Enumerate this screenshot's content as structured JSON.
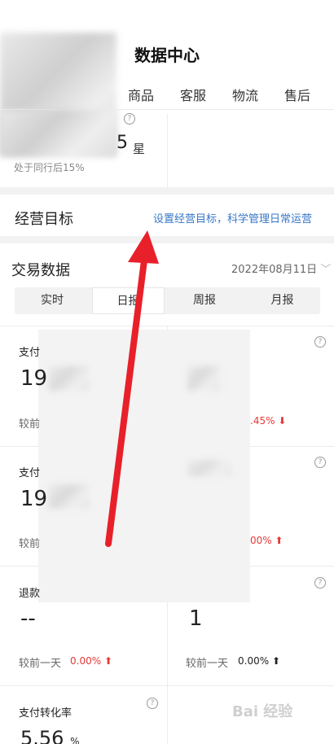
{
  "header": {
    "title": "数据中心"
  },
  "tabs": [
    "商品",
    "客服",
    "物流",
    "售后"
  ],
  "shop_score": {
    "value_suffix": "5",
    "unit": "星",
    "rank_text": "处于同行后15%"
  },
  "business_goal": {
    "title": "经营目标",
    "link": "设置经营目标，科学管理日常运营"
  },
  "trade": {
    "title": "交易数据",
    "date": "2022年08月11日",
    "periods": [
      "实时",
      "日报",
      "周报",
      "月报"
    ],
    "active_period": "日报"
  },
  "metrics": [
    {
      "label": "支付",
      "value": "19",
      "cmp_label": "较前",
      "pct": ".45%",
      "pct_color": "#e53935",
      "trend": "down"
    },
    {
      "label": "支付",
      "value": "19",
      "cmp_label": "较前",
      "pct": "00%",
      "pct_color": "#e53935",
      "trend": "up"
    },
    {
      "label": "退款",
      "value": "--",
      "cmp_label": "较前一天",
      "pct": "0.00%",
      "pct_color": "#e53935",
      "trend": "up"
    },
    {
      "label": "",
      "value": "1",
      "cmp_label": "较前一天",
      "pct": "0.00%",
      "pct_color": "#222222",
      "trend": "up"
    },
    {
      "label": "支付转化率",
      "value": "5.56",
      "unit": "%"
    }
  ],
  "watermark": "Bai 经验",
  "colors": {
    "accent_link": "#3877c7",
    "annotation_arrow": "#e8202a",
    "negative": "#e53935"
  }
}
